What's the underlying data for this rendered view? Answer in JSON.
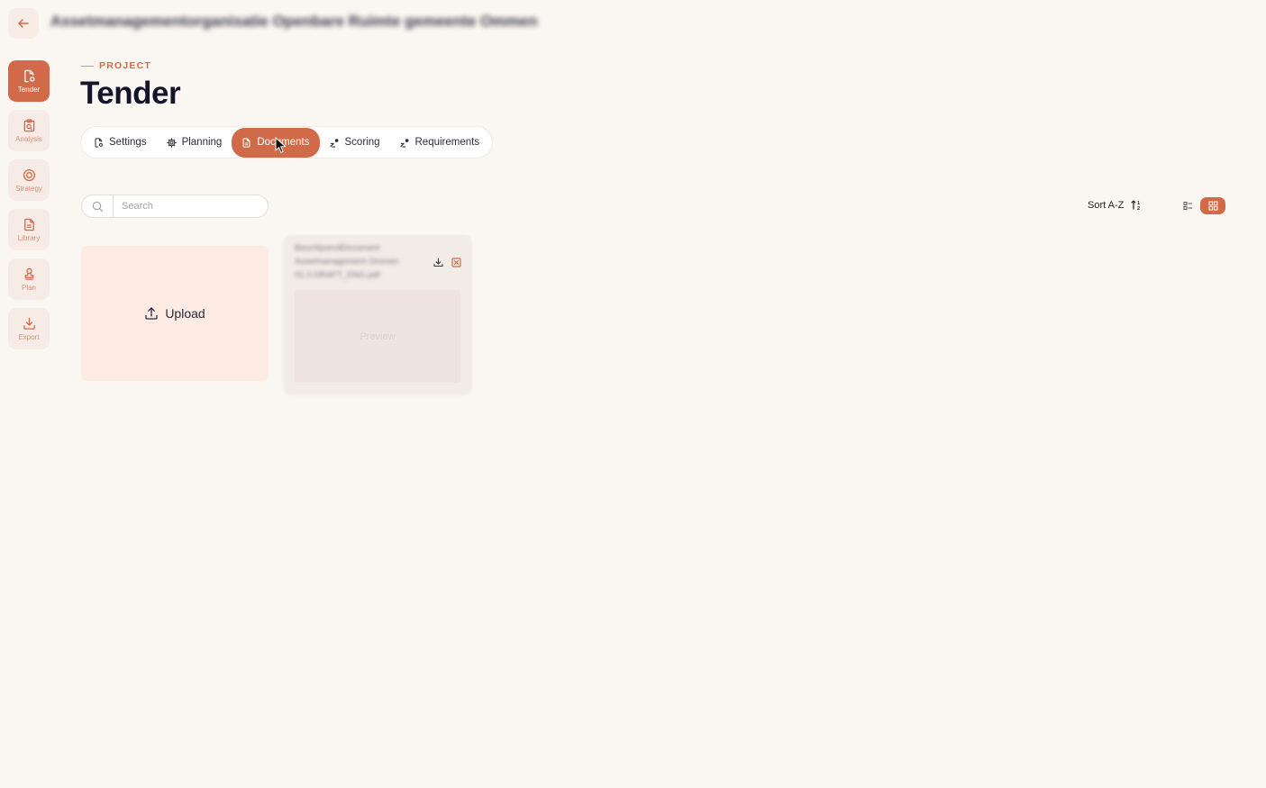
{
  "header": {
    "org_name": "Assetmanagementorganisatie Openbare Ruimte gemeente Ommen",
    "eyebrow": "PROJECT",
    "title": "Tender"
  },
  "sidebar": {
    "items": [
      {
        "label": "Tender",
        "icon": "file-settings-icon",
        "active": true
      },
      {
        "label": "Analysis",
        "icon": "clipboard-search-icon",
        "active": false
      },
      {
        "label": "Strategy",
        "icon": "target-icon",
        "active": false
      },
      {
        "label": "Library",
        "icon": "document-icon",
        "active": false
      },
      {
        "label": "Plan",
        "icon": "stamp-icon",
        "active": false
      },
      {
        "label": "Export",
        "icon": "download-icon",
        "active": false
      }
    ]
  },
  "tabs": [
    {
      "label": "Settings",
      "icon": "file-settings-icon",
      "active": false
    },
    {
      "label": "Planning",
      "icon": "gear-icon",
      "active": false
    },
    {
      "label": "Documents",
      "icon": "document-icon",
      "active": true
    },
    {
      "label": "Scoring",
      "icon": "score-icon",
      "active": false
    },
    {
      "label": "Requirements",
      "icon": "score-icon",
      "active": false
    }
  ],
  "search": {
    "placeholder": "Search",
    "value": ""
  },
  "sort": {
    "label": "Sort A-Z"
  },
  "view": {
    "selected": "grid"
  },
  "upload": {
    "label": "Upload"
  },
  "documents": [
    {
      "name": "BeschijvendDocument Assetmanagement Ommen 01.0.DRAFT_ENG.pdf",
      "preview_label": "Preview"
    }
  ],
  "colors": {
    "accent": "#d16a48",
    "background": "#faf6f2",
    "upload_bg": "#fdebe4"
  }
}
